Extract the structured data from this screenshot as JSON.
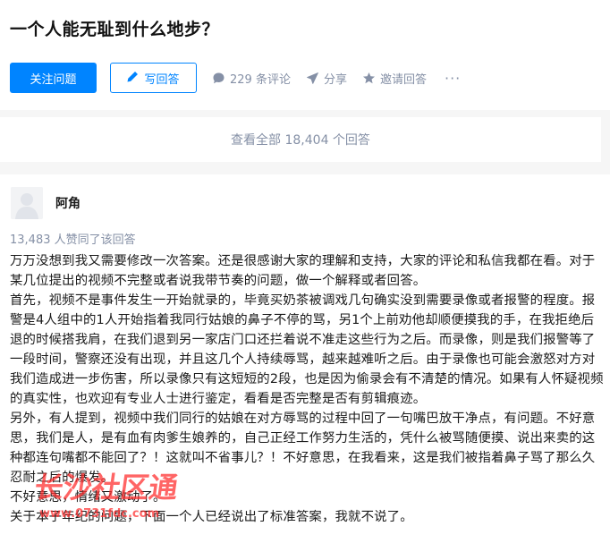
{
  "question": {
    "title": "一个人能无耻到什么地步？"
  },
  "actions": {
    "follow_label": "关注问题",
    "write_label": "写回答",
    "comments_label": "229 条评论",
    "share_label": "分享",
    "invite_label": "邀请回答",
    "more_label": "···",
    "icons": [
      "pencil-icon",
      "comment-icon",
      "share-icon",
      "star-icon"
    ],
    "accent_color": "#0084ff"
  },
  "view_all": {
    "label": "查看全部 18,404 个回答"
  },
  "answer": {
    "author": "阿角",
    "votes": "13,483 人赞同了该回答",
    "paragraphs": [
      "万万没想到我又需要修改一次答案。还是很感谢大家的理解和支持，大家的评论和私信我都在看。对于某几位提出的视频不完整或者说我带节奏的问题，做一个解释或者回答。",
      "首先，视频不是事件发生一开始就录的，毕竟买奶茶被调戏几句确实没到需要录像或者报警的程度。报警是4人组中的1人开始指着我同行姑娘的鼻子不停的骂，另1个上前劝他却顺便摸我的手，在我拒绝后退的时候搭我肩，在我们退到另一家店门口还拦着说不准走这些行为之后。而录像，则是我们报警等了一段时间，警察还没有出现，并且这几个人持续辱骂，越来越难听之后。由于录像也可能会激怒对方对我们造成进一步伤害，所以录像只有这短短的2段，也是因为偷录会有不清楚的情况。如果有人怀疑视频的真实性，也欢迎有专业人士进行鉴定，看看是否完整是否有剪辑痕迹。",
      "另外，有人提到，视频中我们同行的姑娘在对方辱骂的过程中回了一句嘴巴放干净点，有问题。不好意思，我们是人，是有血有肉爹生娘养的，自己正经工作努力生活的，凭什么被骂随便摸、说出来卖的这种都连句嘴都不能回了？！这就叫不省事儿？！不好意思，在我看来，这是我们被指着鼻子骂了那么久忍耐之后的爆发。",
      "不好意思，情绪又激动了。",
      "关于本子年纪的问题，下面一个人已经说出了标准答案，我就不说了。"
    ]
  },
  "watermark": {
    "text": "长沙社区通",
    "url": "www.0731fdc.com",
    "color": "#ff2a2a"
  }
}
